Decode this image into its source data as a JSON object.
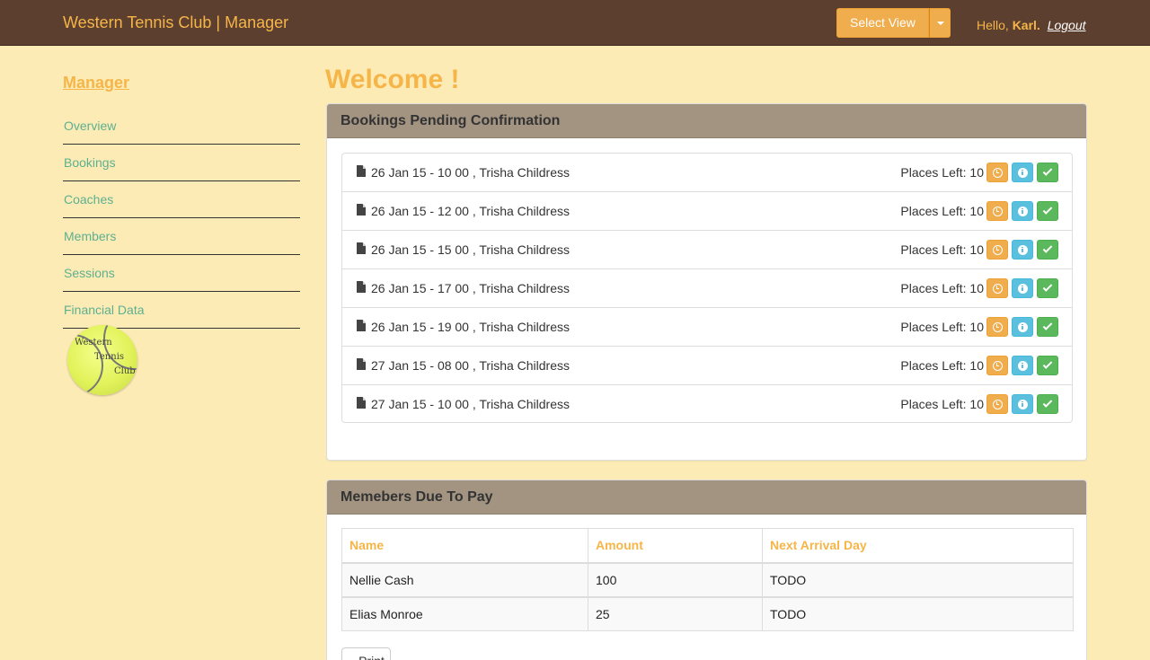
{
  "header": {
    "brand": "Western Tennis Club | Manager",
    "select_view_label": "Select View",
    "hello_prefix": "Hello,",
    "user_name": "Karl.",
    "logout_label": "Logout"
  },
  "sidebar": {
    "title": "Manager",
    "items": [
      {
        "label": "Overview"
      },
      {
        "label": "Bookings"
      },
      {
        "label": "Coaches"
      },
      {
        "label": "Members"
      },
      {
        "label": "Sessions"
      },
      {
        "label": "Financial Data"
      }
    ],
    "logo_text": [
      "Western",
      "Tennis",
      "Club"
    ]
  },
  "main": {
    "welcome": "Welcome !",
    "pending": {
      "heading": "Bookings Pending Confirmation",
      "items": [
        {
          "text": "26 Jan 15 - 10 00 , Trisha Childress",
          "places": "Places Left: 10"
        },
        {
          "text": "26 Jan 15 - 12 00 , Trisha Childress",
          "places": "Places Left: 10"
        },
        {
          "text": "26 Jan 15 - 15 00 , Trisha Childress",
          "places": "Places Left: 10"
        },
        {
          "text": "26 Jan 15 - 17 00 , Trisha Childress",
          "places": "Places Left: 10"
        },
        {
          "text": "26 Jan 15 - 19 00 , Trisha Childress",
          "places": "Places Left: 10"
        },
        {
          "text": "27 Jan 15 - 08 00 , Trisha Childress",
          "places": "Places Left: 10"
        },
        {
          "text": "27 Jan 15 - 10 00 , Trisha Childress",
          "places": "Places Left: 10"
        }
      ]
    },
    "due": {
      "heading": "Memebers Due To Pay",
      "columns": [
        "Name",
        "Amount",
        "Next Arrival Day"
      ],
      "rows": [
        [
          "Nellie Cash",
          "100",
          "TODO"
        ],
        [
          "Elias Monroe",
          "25",
          "TODO"
        ]
      ],
      "print_label": "Print"
    }
  },
  "colors": {
    "navbar": "#5c3f2e",
    "background": "#fdebb6",
    "accent": "#f5b549",
    "panel_heading": "#a39482",
    "link_green": "#5cb08f"
  }
}
